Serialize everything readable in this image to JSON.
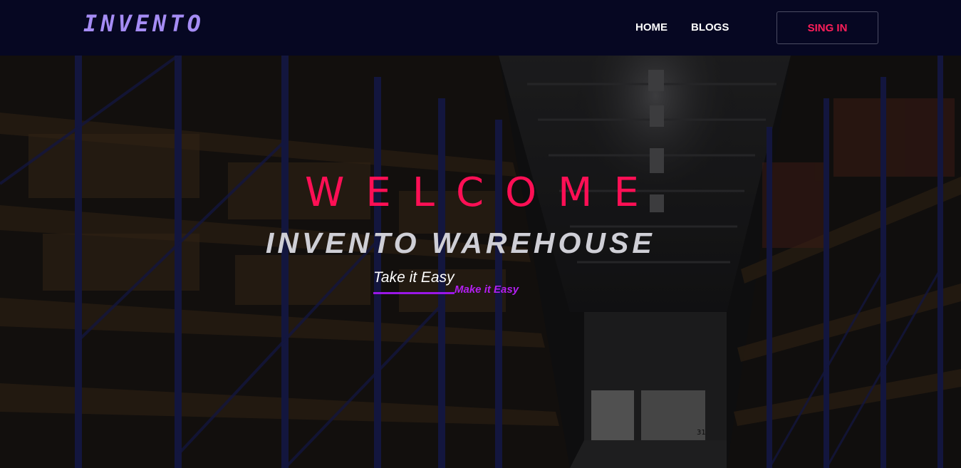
{
  "navbar": {
    "brand": "INVENTO",
    "links": [
      {
        "label": "HOME"
      },
      {
        "label": "BLOGS"
      }
    ],
    "signin_label": "SING IN"
  },
  "hero": {
    "welcome": "WELCOME",
    "title": "INVENTO WAREHOUSE",
    "tagline_primary": "Take it Easy",
    "tagline_secondary": "Make it Easy",
    "background_image": "warehouse aisle photo",
    "shelf_number": "31"
  },
  "colors": {
    "navbar_bg": "#060722",
    "brand": "#a58cf5",
    "signin_text": "#ff1e5a",
    "welcome": "#ff0f55",
    "title": "#cfcfd6",
    "accent_purple": "#9a17e6"
  }
}
